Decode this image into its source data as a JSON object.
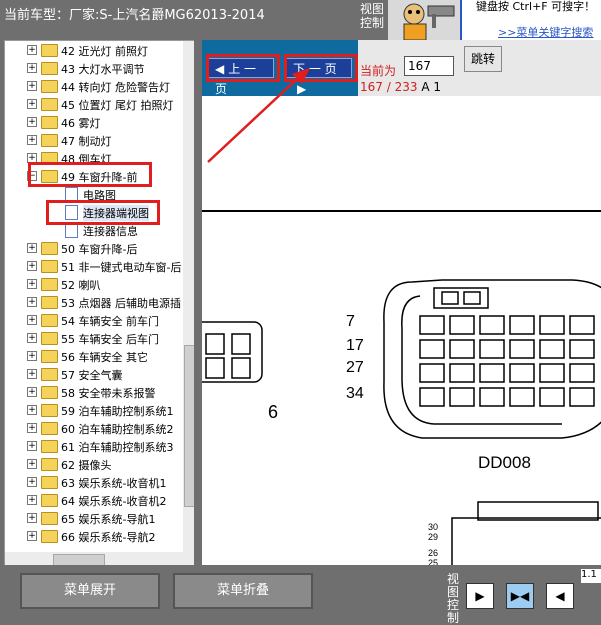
{
  "header": {
    "car_title": "当前车型：厂家:S-上汽名爵MG62013-2014",
    "view_control_label": "视图控制",
    "help_text": "键盘按 Ctrl+F 可搜字！",
    "help_link": ">>菜单关键字搜索"
  },
  "tree": {
    "items": [
      {
        "label": "42 近光灯 前照灯"
      },
      {
        "label": "43 大灯水平调节"
      },
      {
        "label": "44 转向灯 危险警告灯"
      },
      {
        "label": "45 位置灯 尾灯 拍照灯"
      },
      {
        "label": "46 雾灯"
      },
      {
        "label": "47 制动灯"
      },
      {
        "label": "48 倒车灯"
      },
      {
        "label": "49 车窗升降-前",
        "expanded": true
      },
      {
        "label": "电路图",
        "child": true
      },
      {
        "label": "连接器端视图",
        "child": true,
        "selected": true
      },
      {
        "label": "连接器信息",
        "child": true
      },
      {
        "label": "50 车窗升降-后"
      },
      {
        "label": "51 非一键式电动车窗-后"
      },
      {
        "label": "52 喇叭"
      },
      {
        "label": "53 点烟器 后辅助电源插"
      },
      {
        "label": "54 车辆安全 前车门"
      },
      {
        "label": "55 车辆安全 后车门"
      },
      {
        "label": "56 车辆安全 其它"
      },
      {
        "label": "57 安全气囊"
      },
      {
        "label": "58 安全带未系报警"
      },
      {
        "label": "59 泊车辅助控制系统1"
      },
      {
        "label": "60 泊车辅助控制系统2"
      },
      {
        "label": "61 泊车辅助控制系统3"
      },
      {
        "label": "62 摄像头"
      },
      {
        "label": "63 娱乐系统-收音机1"
      },
      {
        "label": "64 娱乐系统-收音机2"
      },
      {
        "label": "65 娱乐系统-导航1"
      },
      {
        "label": "66 娱乐系统-导航2"
      }
    ]
  },
  "viewer": {
    "prev_label": "上 一 页",
    "next_label": "下 一 页",
    "current_page_label": "当前为",
    "current_page_value": "167",
    "jump_label": "跳转",
    "page_position": "167 / 233",
    "page_suffix": "A 1",
    "diagram": {
      "left_pin": "6",
      "pin_labels": [
        "7",
        "17",
        "27",
        "34"
      ],
      "connector_name": "DD008",
      "bottom_pins": [
        "30",
        "29",
        "26",
        "25"
      ]
    }
  },
  "bottom": {
    "expand_label": "菜单展开",
    "collapse_label": "菜单折叠",
    "view_control_label": "视图控制",
    "version": "1.1"
  },
  "colors": {
    "accent_red": "#e01e1e",
    "nav_blue": "#0f6aa0",
    "button_blue": "#1c3f9a"
  }
}
